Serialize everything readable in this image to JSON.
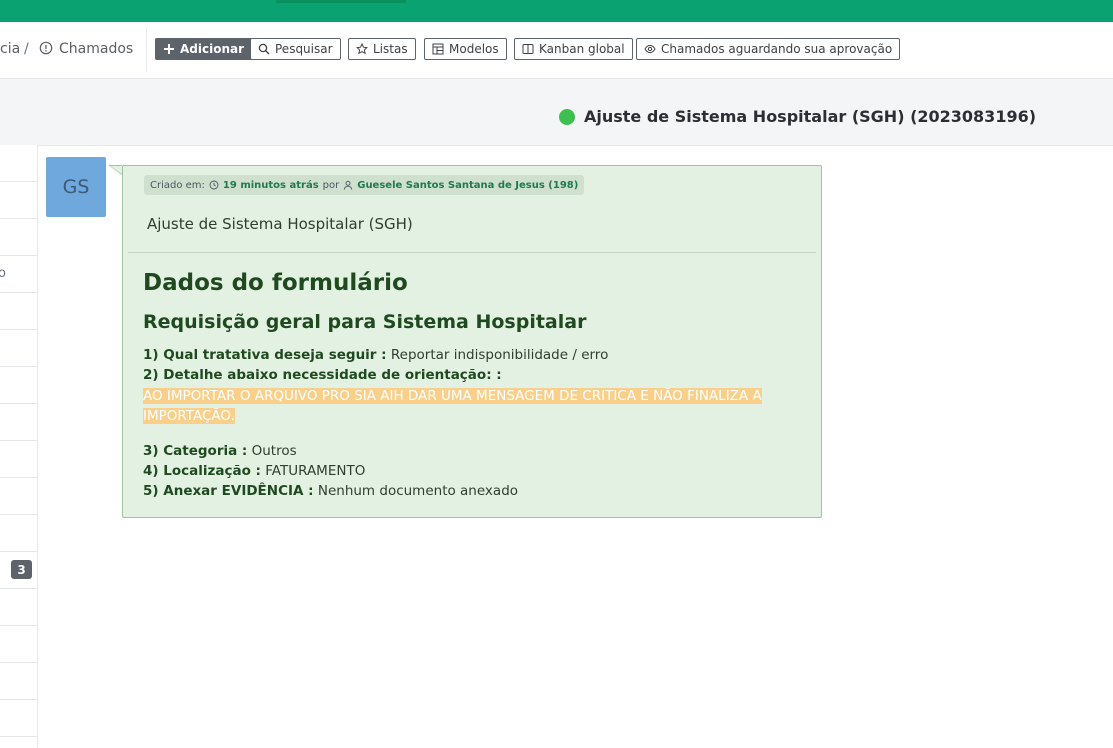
{
  "breadcrumb": {
    "prev": "cia",
    "sep": "/",
    "current": "Chamados"
  },
  "toolbar": {
    "add": "Adicionar",
    "search": "Pesquisar",
    "lists": "Listas",
    "models": "Modelos",
    "kanban": "Kanban global",
    "pending": "Chamados aguardando sua aprovação"
  },
  "ticket": {
    "title": "Ajuste de Sistema Hospitalar (SGH) (2023083196)",
    "status_color": "#3fbf4f"
  },
  "sidebar": {
    "partial_char": "o",
    "badge": "3"
  },
  "followup": {
    "avatar_initials": "GS",
    "created_label": "Criado em:",
    "created_time": "19 minutos atrás",
    "by": "por",
    "author": "Guesele Santos Santana de Jesus (198)",
    "title": "Ajuste de Sistema Hospitalar (SGH)",
    "form_heading": "Dados do formulário",
    "form_subheading": "Requisição geral para Sistema Hospitalar",
    "fields": [
      {
        "label": "1) Qual tratativa deseja seguir :",
        "value": "Reportar indisponibilidade / erro"
      },
      {
        "label": "2) Detalhe abaixo necessidade de orientação: :",
        "value": ""
      },
      {
        "label": "3) Categoria :",
        "value": "Outros"
      },
      {
        "label": "4) Localização :",
        "value": "FATURAMENTO"
      },
      {
        "label": "5) Anexar EVIDÊNCIA :",
        "value": "Nenhum documento anexado"
      }
    ],
    "highlight_text": "AO IMPORTAR O ARQUIVO PRO SIA AIH DAR UMA MENSAGEM DE CRITICA E NÃO FINALIZA A IMPORTAÇÃO.",
    "highlight_color": "#f9cf8a"
  }
}
